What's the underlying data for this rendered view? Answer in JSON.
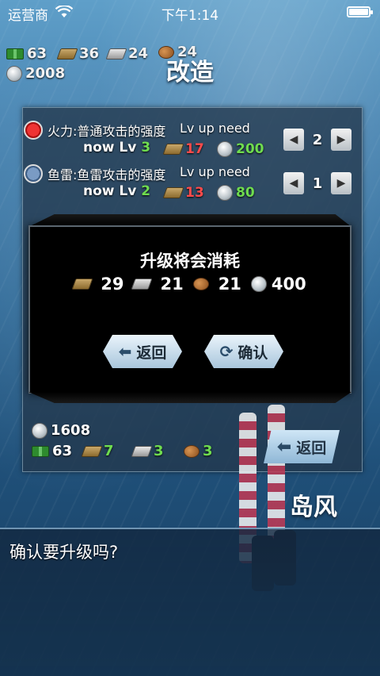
{
  "status_bar": {
    "carrier": "运营商",
    "time": "下午1:14"
  },
  "resources_top": {
    "fuel": "63",
    "ammo": "36",
    "steel": "24",
    "bauxite": "24",
    "coins": "2008"
  },
  "page_title": "改造",
  "upgrades": [
    {
      "icon": "fire-icon",
      "name": "火力:普通攻击的强度",
      "need_label": "Lv up need",
      "now_label": "now Lv",
      "level": "3",
      "ammo_cost": "17",
      "coin_cost": "200",
      "count": "2"
    },
    {
      "icon": "torpedo-icon",
      "name": "鱼雷:鱼雷攻击的强度",
      "need_label": "Lv up need",
      "now_label": "now Lv",
      "level": "2",
      "ammo_cost": "13",
      "coin_cost": "80",
      "count": "1"
    }
  ],
  "bottom_resources": {
    "coins": "1608",
    "fuel": "63",
    "ammo": "7",
    "steel": "3",
    "bauxite": "3"
  },
  "back_button_label": "返回",
  "ship_name": "岛风",
  "dialog_text": "确认要升级吗?",
  "modal": {
    "title": "升级将会消耗",
    "costs": {
      "ammo": "29",
      "steel": "21",
      "bauxite": "21",
      "coins": "400"
    },
    "back_label": "返回",
    "confirm_label": "确认"
  },
  "colors": {
    "cost_red": "#ff4b4b",
    "value_green": "#6fdc4f"
  }
}
